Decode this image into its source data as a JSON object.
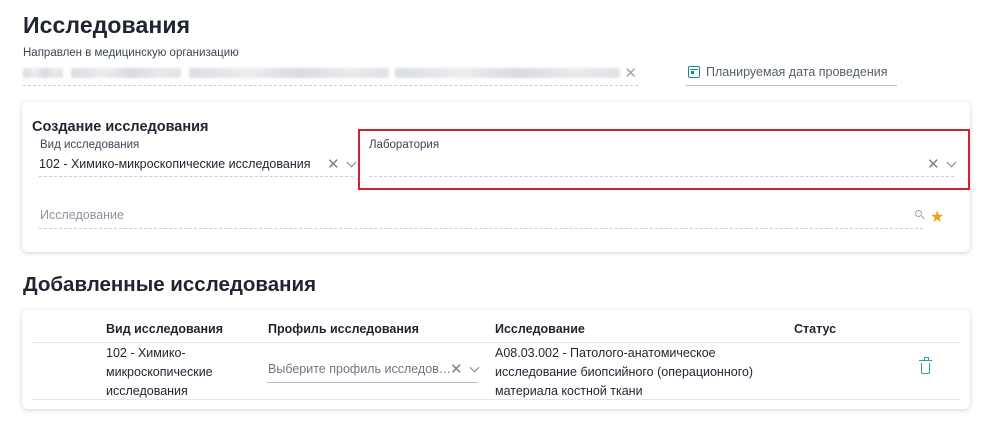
{
  "page": {
    "title": "Исследования",
    "referred_label": "Направлен в медицинскую организацию",
    "referred_clear_icon": "close-icon",
    "planned_date_placeholder": "Планируемая дата проведения",
    "planned_date_icon": "calendar-icon"
  },
  "create_card": {
    "title": "Создание исследования",
    "study_type": {
      "label": "Вид исследования",
      "value": "102 - Химико-микроскопические исследования"
    },
    "laboratory": {
      "label": "Лаборатория",
      "value": ""
    },
    "study": {
      "placeholder": "Исследование",
      "icons": [
        "search-icon",
        "star-icon"
      ]
    },
    "colors": {
      "highlight": "#d3232a",
      "star": "#f0a11c",
      "accent": "#1a8a8a"
    }
  },
  "added_card": {
    "title": "Добавленные исследования",
    "columns": [
      "Вид исследования",
      "Профиль исследования",
      "Исследование",
      "Статус"
    ],
    "rows": [
      {
        "study_type": "102 - Химико-микроскопические исследования",
        "study_type_lines": [
          "102 - Химико-",
          "микроскопические",
          "исследования"
        ],
        "profile_placeholder": "Выберите профиль исследования",
        "study": "A08.03.002 - Патолого-анатомическое исследование биопсийного (операционного) материала костной ткани",
        "study_lines": [
          "A08.03.002 - Патолого-анатомическое",
          "исследование биопсийного (операционного)",
          "материала костной ткани"
        ],
        "status": "",
        "action_icon": "trash-icon"
      }
    ]
  }
}
